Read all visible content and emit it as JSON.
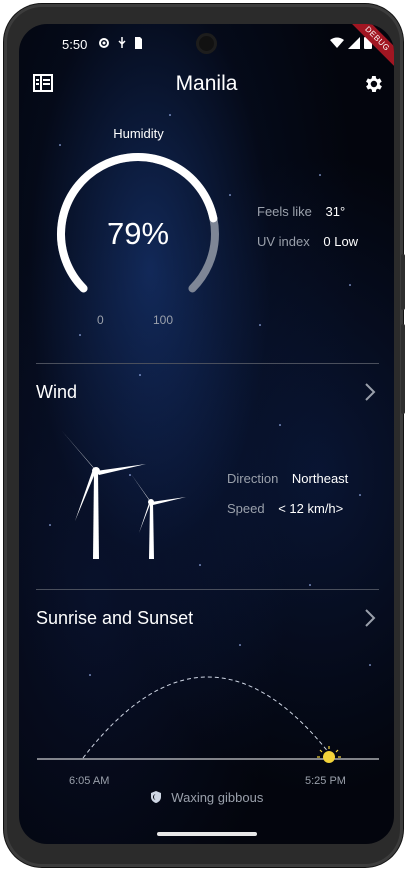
{
  "status_bar": {
    "time": "5:50",
    "debug_label": "DEBUG"
  },
  "app_bar": {
    "city": "Manila",
    "left_icon": "list-icon",
    "right_icon": "gear-icon"
  },
  "humidity": {
    "label": "Humidity",
    "value_text": "79%",
    "value": 79,
    "min": "0",
    "max": "100",
    "details": [
      {
        "label": "Feels like",
        "value": "31°"
      },
      {
        "label": "UV index",
        "value": "0 Low"
      }
    ]
  },
  "wind": {
    "title": "Wind",
    "details": [
      {
        "label": "Direction",
        "value": "Northeast"
      },
      {
        "label": "Speed",
        "value": "< 12 km/h>"
      }
    ]
  },
  "sun": {
    "title": "Sunrise and Sunset",
    "sunrise": "6:05 AM",
    "sunset": "5:25 PM",
    "moon_phase": "Waxing gibbous"
  },
  "colors": {
    "track": "#7e8696",
    "fill": "#ffffff",
    "sun": "#f3d33a"
  }
}
